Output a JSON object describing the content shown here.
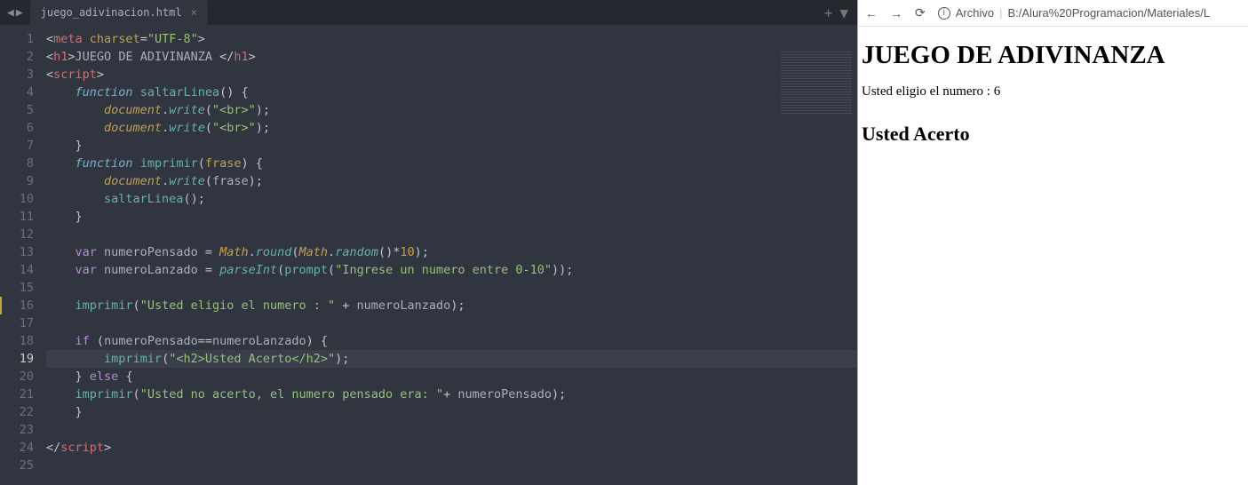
{
  "editor": {
    "tab_name": "juego_adivinacion.html",
    "active_line": 19,
    "marked_line": 16,
    "lines": [
      [
        {
          "c": "t-punct",
          "t": "<"
        },
        {
          "c": "t-tag",
          "t": "meta"
        },
        {
          "c": "",
          "t": " "
        },
        {
          "c": "t-attr",
          "t": "charset"
        },
        {
          "c": "t-punct",
          "t": "="
        },
        {
          "c": "t-str",
          "t": "\"UTF-8\""
        },
        {
          "c": "t-punct",
          "t": ">"
        }
      ],
      [
        {
          "c": "t-punct",
          "t": "<"
        },
        {
          "c": "t-tag",
          "t": "h1"
        },
        {
          "c": "t-punct",
          "t": ">"
        },
        {
          "c": "",
          "t": "JUEGO DE ADIVINANZA "
        },
        {
          "c": "t-punct",
          "t": "</"
        },
        {
          "c": "t-tag",
          "t": "h1"
        },
        {
          "c": "t-punct",
          "t": ">"
        }
      ],
      [
        {
          "c": "t-punct",
          "t": "<"
        },
        {
          "c": "t-tag",
          "t": "script"
        },
        {
          "c": "t-punct",
          "t": ">"
        }
      ],
      [
        {
          "c": "",
          "t": "    "
        },
        {
          "c": "t-fn",
          "t": "function"
        },
        {
          "c": "",
          "t": " "
        },
        {
          "c": "t-func",
          "t": "saltarLinea"
        },
        {
          "c": "t-punct",
          "t": "() {"
        }
      ],
      [
        {
          "c": "",
          "t": "        "
        },
        {
          "c": "t-obj",
          "t": "document"
        },
        {
          "c": "t-punct",
          "t": "."
        },
        {
          "c": "t-prop",
          "t": "write"
        },
        {
          "c": "t-punct",
          "t": "("
        },
        {
          "c": "t-str",
          "t": "\"<br>\""
        },
        {
          "c": "t-punct",
          "t": ");"
        }
      ],
      [
        {
          "c": "",
          "t": "        "
        },
        {
          "c": "t-obj",
          "t": "document"
        },
        {
          "c": "t-punct",
          "t": "."
        },
        {
          "c": "t-prop",
          "t": "write"
        },
        {
          "c": "t-punct",
          "t": "("
        },
        {
          "c": "t-str",
          "t": "\"<br>\""
        },
        {
          "c": "t-punct",
          "t": ");"
        }
      ],
      [
        {
          "c": "",
          "t": "    "
        },
        {
          "c": "t-punct",
          "t": "}"
        }
      ],
      [
        {
          "c": "",
          "t": "    "
        },
        {
          "c": "t-fn",
          "t": "function"
        },
        {
          "c": "",
          "t": " "
        },
        {
          "c": "t-func",
          "t": "imprimir"
        },
        {
          "c": "t-punct",
          "t": "("
        },
        {
          "c": "t-attr",
          "t": "frase"
        },
        {
          "c": "t-punct",
          "t": ") {"
        }
      ],
      [
        {
          "c": "",
          "t": "        "
        },
        {
          "c": "t-obj",
          "t": "document"
        },
        {
          "c": "t-punct",
          "t": "."
        },
        {
          "c": "t-prop",
          "t": "write"
        },
        {
          "c": "t-punct",
          "t": "("
        },
        {
          "c": "",
          "t": "frase"
        },
        {
          "c": "t-punct",
          "t": ");"
        }
      ],
      [
        {
          "c": "",
          "t": "        "
        },
        {
          "c": "t-func",
          "t": "saltarLinea"
        },
        {
          "c": "t-punct",
          "t": "();"
        }
      ],
      [
        {
          "c": "",
          "t": "    "
        },
        {
          "c": "t-punct",
          "t": "}"
        }
      ],
      [],
      [
        {
          "c": "",
          "t": "    "
        },
        {
          "c": "t-key",
          "t": "var"
        },
        {
          "c": "",
          "t": " numeroPensado "
        },
        {
          "c": "t-punct",
          "t": "= "
        },
        {
          "c": "t-obj",
          "t": "Math"
        },
        {
          "c": "t-punct",
          "t": "."
        },
        {
          "c": "t-prop",
          "t": "round"
        },
        {
          "c": "t-punct",
          "t": "("
        },
        {
          "c": "t-obj",
          "t": "Math"
        },
        {
          "c": "t-punct",
          "t": "."
        },
        {
          "c": "t-prop",
          "t": "random"
        },
        {
          "c": "t-punct",
          "t": "()"
        },
        {
          "c": "t-op",
          "t": "*"
        },
        {
          "c": "t-num",
          "t": "10"
        },
        {
          "c": "t-punct",
          "t": ");"
        }
      ],
      [
        {
          "c": "",
          "t": "    "
        },
        {
          "c": "t-key",
          "t": "var"
        },
        {
          "c": "",
          "t": " numeroLanzado "
        },
        {
          "c": "t-punct",
          "t": "= "
        },
        {
          "c": "t-prop",
          "t": "parseInt"
        },
        {
          "c": "t-punct",
          "t": "("
        },
        {
          "c": "t-func",
          "t": "prompt"
        },
        {
          "c": "t-punct",
          "t": "("
        },
        {
          "c": "t-str",
          "t": "\"Ingrese un numero entre 0-10\""
        },
        {
          "c": "t-punct",
          "t": "));"
        }
      ],
      [],
      [
        {
          "c": "",
          "t": "    "
        },
        {
          "c": "t-func",
          "t": "imprimir"
        },
        {
          "c": "t-punct",
          "t": "("
        },
        {
          "c": "t-str",
          "t": "\"Usted eligio el numero : \""
        },
        {
          "c": "",
          "t": " "
        },
        {
          "c": "t-op",
          "t": "+"
        },
        {
          "c": "",
          "t": " numeroLanzado"
        },
        {
          "c": "t-punct",
          "t": ");"
        }
      ],
      [],
      [
        {
          "c": "",
          "t": "    "
        },
        {
          "c": "t-key",
          "t": "if"
        },
        {
          "c": "",
          "t": " "
        },
        {
          "c": "t-punct",
          "t": "("
        },
        {
          "c": "",
          "t": "numeroPensado"
        },
        {
          "c": "t-op",
          "t": "=="
        },
        {
          "c": "",
          "t": "numeroLanzado"
        },
        {
          "c": "t-punct",
          "t": ") {"
        }
      ],
      [
        {
          "c": "",
          "t": "        "
        },
        {
          "c": "t-func",
          "t": "imprimir"
        },
        {
          "c": "t-punct",
          "t": "("
        },
        {
          "c": "t-str",
          "t": "\"<h2>Usted Acerto</h2>\""
        },
        {
          "c": "t-punct",
          "t": ");"
        }
      ],
      [
        {
          "c": "",
          "t": "    "
        },
        {
          "c": "t-punct",
          "t": "} "
        },
        {
          "c": "t-key",
          "t": "else"
        },
        {
          "c": "",
          "t": " "
        },
        {
          "c": "t-punct",
          "t": "{"
        }
      ],
      [
        {
          "c": "",
          "t": "    "
        },
        {
          "c": "t-func",
          "t": "imprimir"
        },
        {
          "c": "t-punct",
          "t": "("
        },
        {
          "c": "t-str",
          "t": "\"Usted no acerto, el numero pensado era: \""
        },
        {
          "c": "t-op",
          "t": "+"
        },
        {
          "c": "",
          "t": " numeroPensado"
        },
        {
          "c": "t-punct",
          "t": ");"
        }
      ],
      [
        {
          "c": "",
          "t": "    "
        },
        {
          "c": "t-punct",
          "t": "}"
        }
      ],
      [],
      [
        {
          "c": "t-punct",
          "t": "</"
        },
        {
          "c": "t-tag",
          "t": "script"
        },
        {
          "c": "t-punct",
          "t": ">"
        }
      ],
      []
    ]
  },
  "browser": {
    "url_prefix": "Archivo",
    "url_path": "B:/Alura%20Programacion/Materiales/L",
    "page_heading": "JUEGO DE ADIVINANZA",
    "page_message": "Usted eligio el numero : 6",
    "page_result": "Usted Acerto"
  }
}
